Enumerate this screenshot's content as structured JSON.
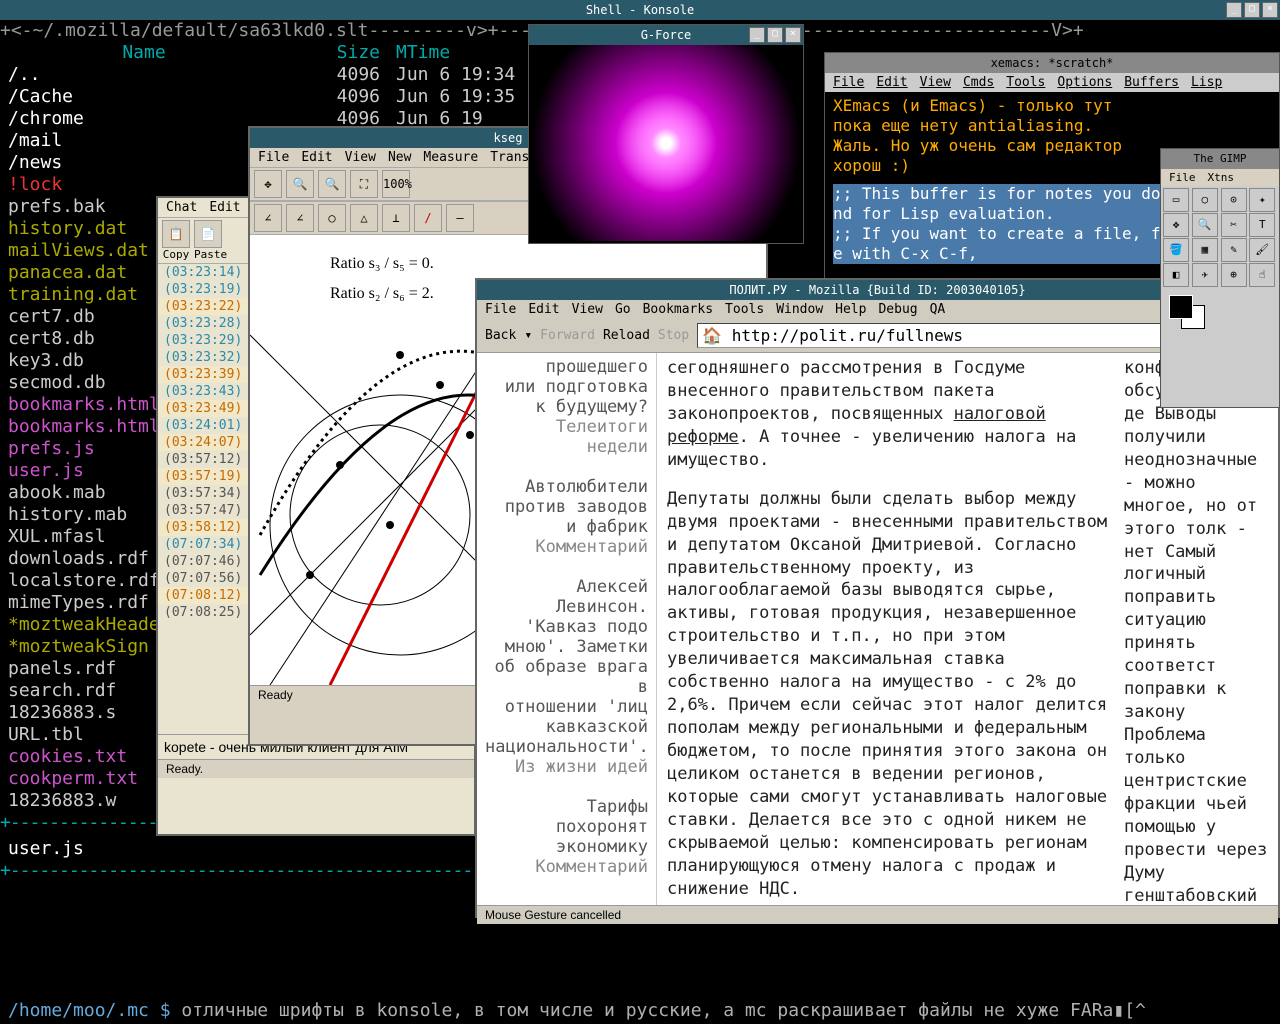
{
  "konsole": {
    "title": "Shell - Konsole"
  },
  "mc": {
    "header": "+<-~/.mozilla/default/sa63lkd0.slt---------v>+---------------------------------------------------V>+",
    "cols": {
      "name": "Name",
      "size": "Size",
      "mtime": "MTime"
    },
    "rows": [
      {
        "n": "/..",
        "s": "4096",
        "t": "Jun  6 19:34",
        "c": "f-dir"
      },
      {
        "n": "/Cache",
        "s": "4096",
        "t": "Jun  6 19:35",
        "c": "f-dir"
      },
      {
        "n": "/chrome",
        "s": "4096",
        "t": "Jun  6 19",
        "c": "f-dir"
      },
      {
        "n": "/mail",
        "s": "",
        "t": "",
        "c": "f-dir"
      },
      {
        "n": "/news",
        "s": "",
        "t": "",
        "c": "f-dir"
      },
      {
        "n": "!lock",
        "s": "",
        "t": "",
        "c": "f-lock"
      },
      {
        "n": " prefs.bak",
        "s": "",
        "t": "",
        "c": ""
      },
      {
        "n": " history.dat",
        "s": "",
        "t": "",
        "c": "f-dat"
      },
      {
        "n": " mailViews.dat",
        "s": "",
        "t": "",
        "c": "f-dat"
      },
      {
        "n": " panacea.dat",
        "s": "",
        "t": "",
        "c": "f-dat"
      },
      {
        "n": " training.dat",
        "s": "",
        "t": "",
        "c": "f-dat"
      },
      {
        "n": " cert7.db",
        "s": "",
        "t": "",
        "c": ""
      },
      {
        "n": " cert8.db",
        "s": "",
        "t": "",
        "c": ""
      },
      {
        "n": " key3.db",
        "s": "",
        "t": "",
        "c": ""
      },
      {
        "n": " secmod.db",
        "s": "",
        "t": "",
        "c": ""
      },
      {
        "n": " bookmarks.html",
        "s": "",
        "t": "",
        "c": "f-ht"
      },
      {
        "n": " bookmarks.html",
        "s": "",
        "t": "",
        "c": "f-ht"
      },
      {
        "n": " prefs.js",
        "s": "",
        "t": "",
        "c": "f-ht"
      },
      {
        "n": " user.js",
        "s": "",
        "t": "",
        "c": "f-ht"
      },
      {
        "n": " abook.mab",
        "s": "",
        "t": "",
        "c": ""
      },
      {
        "n": " history.mab",
        "s": "",
        "t": "",
        "c": ""
      },
      {
        "n": " XUL.mfasl",
        "s": "",
        "t": "",
        "c": ""
      },
      {
        "n": " downloads.rdf",
        "s": "",
        "t": "",
        "c": ""
      },
      {
        "n": " localstore.rdf",
        "s": "",
        "t": "",
        "c": ""
      },
      {
        "n": " mimeTypes.rdf",
        "s": "",
        "t": "",
        "c": ""
      },
      {
        "n": "*moztweakHeader",
        "s": "",
        "t": "",
        "c": "f-moz"
      },
      {
        "n": "*moztweakSign",
        "s": "",
        "t": "",
        "c": "f-moz"
      },
      {
        "n": " panels.rdf",
        "s": "",
        "t": "",
        "c": ""
      },
      {
        "n": " search.rdf",
        "s": "",
        "t": "",
        "c": ""
      },
      {
        "n": " 18236883.s",
        "s": "",
        "t": "",
        "c": ""
      },
      {
        "n": " URL.tbl",
        "s": "",
        "t": "",
        "c": ""
      },
      {
        "n": " cookies.txt",
        "s": "",
        "t": "",
        "c": "f-cookies"
      },
      {
        "n": " cookperm.txt",
        "s": "",
        "t": "",
        "c": "f-cookies"
      },
      {
        "n": " 18236883.w",
        "s": "",
        "t": "",
        "c": ""
      }
    ],
    "foot": " user.js",
    "prompt": "/home/moo/.mc $",
    "shtext": " отличные шрифты в konsole, в том числе и русские, а mc раскрашивает файлы не хуже FARа▮[^"
  },
  "kseg": {
    "title": "kseg",
    "menu": [
      "File",
      "Edit",
      "View",
      "New",
      "Measure",
      "Transform"
    ],
    "ratio1": "Ratio s₃ / s₅ = 0.",
    "ratio2": "Ratio s₂ / s₆ = 2.",
    "status": "Ready"
  },
  "kopete": {
    "menu": [
      "Chat",
      "Edit"
    ],
    "tb": {
      "copy": "Copy",
      "paste": "Paste"
    },
    "ts": [
      {
        "t": "(03:23:14)",
        "c": "ts-cy"
      },
      {
        "t": "(03:23:19)",
        "c": "ts-cy"
      },
      {
        "t": "(03:23:22)",
        "c": "ts-or"
      },
      {
        "t": "(03:23:28)",
        "c": "ts-cy"
      },
      {
        "t": "(03:23:29)",
        "c": "ts-cy"
      },
      {
        "t": "(03:23:32)",
        "c": "ts-cy"
      },
      {
        "t": "(03:23:39)",
        "c": "ts-or"
      },
      {
        "t": "(03:23:43)",
        "c": "ts-cy"
      },
      {
        "t": "(03:23:49)",
        "c": "ts-or"
      },
      {
        "t": "(03:24:01)",
        "c": "ts-cy"
      },
      {
        "t": "(03:24:07)",
        "c": "ts-or"
      },
      {
        "t": "(03:57:12)",
        "c": "ts-gr"
      },
      {
        "t": "(03:57:19)",
        "c": "ts-or"
      },
      {
        "t": "(03:57:34)",
        "c": "ts-gr"
      },
      {
        "t": "(03:57:47)",
        "c": "ts-gr"
      },
      {
        "t": "(03:58:12)",
        "c": "ts-or"
      },
      {
        "t": "(07:07:34)",
        "c": "ts-cy"
      },
      {
        "t": "(07:07:46)",
        "c": "ts-gr"
      },
      {
        "t": "(07:07:56)",
        "c": "ts-gr"
      },
      {
        "t": "(07:08:12)",
        "c": "ts-or"
      },
      {
        "t": "(07:08:25)",
        "c": "ts-gr"
      }
    ],
    "text": "kopete - очень милый клиент для AIM",
    "status": "Ready."
  },
  "gforce": {
    "title": "G-Force"
  },
  "xemacs": {
    "title": "xemacs: *scratch*",
    "menu": [
      "File",
      "Edit",
      "View",
      "Cmds",
      "Tools",
      "Options",
      "Buffers",
      "Lisp"
    ],
    "l1": "XEmacs (и Emacs) - только тут",
    "l2": "пока еще нету antialiasing.",
    "l3": "Жаль. Но уж очень сам редактор",
    "l4": "хорош :)",
    "c1": ";; This buffer is for notes you don",
    "c2": "nd for Lisp evaluation.",
    "c3": ";; If you want to create a file, fi",
    "c4": "e with C-x C-f,"
  },
  "moz": {
    "title": "ПОЛИТ.РУ - Mozilla {Build ID: 2003040105}",
    "menu": [
      "File",
      "Edit",
      "View",
      "Go",
      "Bookmarks",
      "Tools",
      "Window",
      "Help",
      "Debug",
      "QA"
    ],
    "nav": {
      "back": "Back",
      "forward": "Forward",
      "reload": "Reload",
      "stop": "Stop"
    },
    "url": "http://polit.ru/fullnews",
    "side": [
      {
        "t": "прошедшего",
        "c": ""
      },
      {
        "t": "или подготовка",
        "c": ""
      },
      {
        "t": "к будущему?",
        "c": ""
      },
      {
        "t": "Телеитоги",
        "c": "hl"
      },
      {
        "t": "недели",
        "c": "hl"
      },
      {
        "t": "",
        "c": ""
      },
      {
        "t": "Автолюбители",
        "c": ""
      },
      {
        "t": "против заводов",
        "c": ""
      },
      {
        "t": "и фабрик",
        "c": ""
      },
      {
        "t": "Комментарий",
        "c": "k"
      },
      {
        "t": "",
        "c": ""
      },
      {
        "t": "Алексей",
        "c": ""
      },
      {
        "t": "Левинсон.",
        "c": ""
      },
      {
        "t": "'Кавказ подо",
        "c": ""
      },
      {
        "t": "мною'. Заметки",
        "c": ""
      },
      {
        "t": "об образе врага в",
        "c": ""
      },
      {
        "t": "отношении 'лиц",
        "c": ""
      },
      {
        "t": "кавказской",
        "c": ""
      },
      {
        "t": "национальности'.",
        "c": ""
      },
      {
        "t": "Из жизни идей",
        "c": "k"
      },
      {
        "t": "",
        "c": ""
      },
      {
        "t": "Тарифы",
        "c": ""
      },
      {
        "t": "похоронят",
        "c": ""
      },
      {
        "t": "экономику",
        "c": ""
      },
      {
        "t": "Комментарий",
        "c": "k"
      }
    ],
    "p1a": "сегодняшнего рассмотрения в Госдуме внесенного правительством пакета законопроектов, посвященных ",
    "p1u": "налоговой реформе",
    "p1b": ". А точнее - увеличению налога на имущество.",
    "p2": "Депутаты должны были сделать выбор между двумя проектами - внесенными правительством и депутатом Оксаной Дмитриевой. Согласно правительственному проекту, из налогооблагаемой базы выводятся сырье, активы, готовая продукция, незавершенное строительство и т.п., но при этом увеличивается максимальная ставка собственно налога на имущество - с 2% до 2,6%. Причем если сейчас этот налог делится пополам между региональными и федеральным бюджетом, то после принятия этого закона он целиком останется в ведении регионов, которые сами смогут устанавливать налоговые ставки. Делается все это с одной никем не скрываемой целью: компенсировать регионам планирующуюся отмену налога с продаж и снижение НДС.",
    "right": "конференции обсуждали, что де Выводы получили неоднозначные - можно многое, но от этого толк - нет\n\nСамый логичный поправить ситуацию принять соответст поправки к закону Проблема только центристские фракции чьей помощью у провести через Думу генштабовский вариант закона, никакие либеральные поправки принимать не хотят внесено уже порядка законопроектов по смягчению закона 'Яблоко', дублируют",
    "status": "Mouse Gesture cancelled"
  },
  "gimp": {
    "title": "The GIMP",
    "menu": [
      "File",
      "Xtns"
    ]
  }
}
